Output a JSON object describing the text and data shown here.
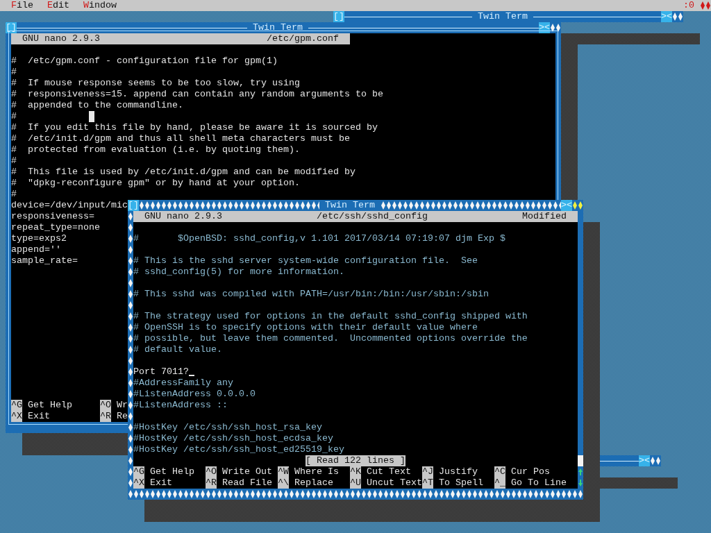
{
  "menu_bar": {
    "items": [
      {
        "label": "File"
      },
      {
        "label": "Edit"
      },
      {
        "label": "Window"
      }
    ],
    "status": ":0"
  },
  "windows": [
    {
      "kind": "bar",
      "title": "Twin Term",
      "focused": false,
      "close_button": "[]",
      "resize_button": "><"
    },
    {
      "kind": "nano",
      "title": "Twin Term",
      "focused": false,
      "close_button": "[]",
      "resize_button": "><",
      "editor": {
        "version": "GNU nano 2.9.3",
        "filename": "/etc/gpm.conf",
        "lines": [
          {
            "kind": "text",
            "text": "#  /etc/gpm.conf - configuration file for gpm(1)"
          },
          {
            "kind": "text",
            "text": "#"
          },
          {
            "kind": "text",
            "text": "#  If mouse response seems to be too slow, try using"
          },
          {
            "kind": "text",
            "text": "#  responsiveness=15. append can contain any random arguments to be"
          },
          {
            "kind": "text",
            "text": "#  appended to the commandline."
          },
          {
            "kind": "text",
            "text": "#"
          },
          {
            "kind": "text",
            "text": "#  If you edit this file by hand, please be aware it is sourced by"
          },
          {
            "kind": "text",
            "text": "#  /etc/init.d/gpm and thus all shell meta characters must be"
          },
          {
            "kind": "text",
            "text": "#  protected from evaluation (i.e. by quoting them)."
          },
          {
            "kind": "text",
            "text": "#"
          },
          {
            "kind": "text",
            "text": "#  This file is used by /etc/init.d/gpm and can be modified by"
          },
          {
            "kind": "text",
            "text": "#  \"dpkg-reconfigure gpm\" or by hand at your option."
          },
          {
            "kind": "text",
            "text": "#"
          },
          {
            "kind": "text",
            "text": "device=/dev/input/mic"
          },
          {
            "kind": "text",
            "text": "responsiveness="
          },
          {
            "kind": "text",
            "text": "repeat_type=none"
          },
          {
            "kind": "text",
            "text": "type=exps2"
          },
          {
            "kind": "text",
            "text": "append=''"
          },
          {
            "kind": "text",
            "text": "sample_rate="
          }
        ],
        "shortcuts": [
          [
            {
              "key": "^G",
              "label": "Get Help"
            },
            {
              "key": "^O",
              "label": "Wr"
            }
          ],
          [
            {
              "key": "^X",
              "label": "Exit"
            },
            {
              "key": "^R",
              "label": "Re"
            }
          ]
        ]
      }
    },
    {
      "kind": "bar",
      "focused": false,
      "resize_button": "><"
    },
    {
      "kind": "nano",
      "title": "Twin Term",
      "focused": true,
      "close_button": "[]",
      "resize_button": "><",
      "editor": {
        "version": "GNU nano 2.9.3",
        "filename": "/etc/ssh/sshd_config",
        "modified": "Modified",
        "lines": [
          {
            "kind": "comment",
            "text": "#       $OpenBSD: sshd_config,v 1.101 2017/03/14 07:19:07 djm Exp $"
          },
          {
            "kind": "blank"
          },
          {
            "kind": "comment",
            "text": "# This is the sshd server system-wide configuration file.  See"
          },
          {
            "kind": "comment",
            "text": "# sshd_config(5) for more information."
          },
          {
            "kind": "blank"
          },
          {
            "kind": "comment",
            "text": "# This sshd was compiled with PATH=/usr/bin:/bin:/usr/sbin:/sbin"
          },
          {
            "kind": "blank"
          },
          {
            "kind": "comment",
            "text": "# The strategy used for options in the default sshd_config shipped with"
          },
          {
            "kind": "comment",
            "text": "# OpenSSH is to specify options with their default value where"
          },
          {
            "kind": "comment",
            "text": "# possible, but leave them commented.  Uncommented options override the"
          },
          {
            "kind": "comment",
            "text": "# default value."
          },
          {
            "kind": "blank"
          },
          {
            "kind": "text",
            "text": "Port 7011?",
            "cursor": true
          },
          {
            "kind": "comment",
            "text": "#AddressFamily any"
          },
          {
            "kind": "comment",
            "text": "#ListenAddress 0.0.0.0"
          },
          {
            "kind": "comment",
            "text": "#ListenAddress ::"
          },
          {
            "kind": "blank"
          },
          {
            "kind": "comment",
            "text": "#HostKey /etc/ssh/ssh_host_rsa_key"
          },
          {
            "kind": "comment",
            "text": "#HostKey /etc/ssh/ssh_host_ecdsa_key"
          },
          {
            "kind": "comment",
            "text": "#HostKey /etc/ssh/ssh_host_ed25519_key"
          }
        ],
        "status": "[ Read 122 lines ]",
        "shortcuts": [
          [
            {
              "key": "^G",
              "label": "Get Help"
            },
            {
              "key": "^O",
              "label": "Write Out"
            },
            {
              "key": "^W",
              "label": "Where Is"
            },
            {
              "key": "^K",
              "label": "Cut Text"
            },
            {
              "key": "^J",
              "label": "Justify"
            },
            {
              "key": "^C",
              "label": "Cur Pos"
            }
          ],
          [
            {
              "key": "^X",
              "label": "Exit"
            },
            {
              "key": "^R",
              "label": "Read File"
            },
            {
              "key": "^\\",
              "label": "Replace"
            },
            {
              "key": "^U",
              "label": "Uncut Text"
            },
            {
              "key": "^T",
              "label": "To Spell"
            },
            {
              "key": "^_",
              "label": "Go To Line"
            }
          ]
        ]
      }
    }
  ]
}
